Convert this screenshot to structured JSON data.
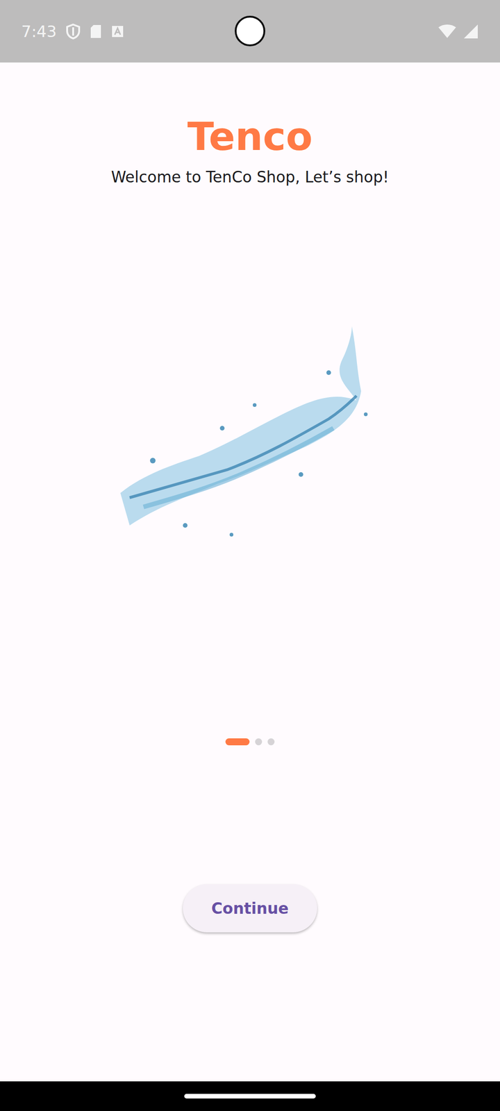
{
  "status_bar": {
    "time": "7:43"
  },
  "title": "Tenco",
  "subtitle": "Welcome to TenCo Shop, Let’s shop!",
  "pager": [
    {
      "selected": true
    },
    {
      "selected": false
    },
    {
      "selected": false
    }
  ],
  "button": {
    "label": "Continue"
  }
}
